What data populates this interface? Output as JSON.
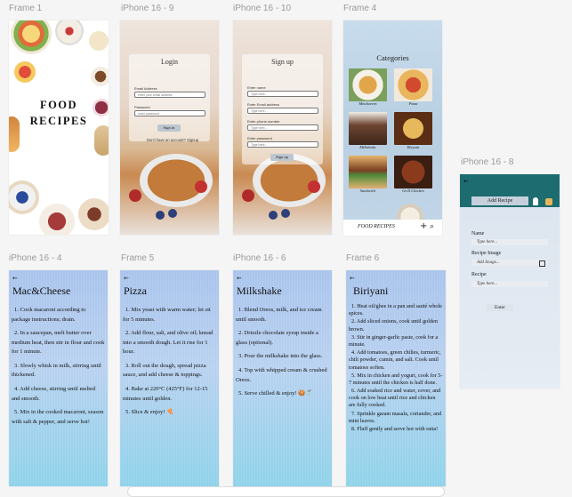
{
  "frames": {
    "frame1": {
      "label": "Frame 1",
      "title_line1": "FOOD",
      "title_line2": "RECIPES"
    },
    "login": {
      "label": "iPhone 16 - 9",
      "title": "Login",
      "email_label": "Email Address",
      "email_placeholder": "enter your email address",
      "password_label": "Password",
      "password_placeholder": "enter password",
      "signin_button": "Sign in",
      "no_account_text": "Don't have an account? Signup"
    },
    "signup": {
      "label": "iPhone 16 - 10",
      "title": "Sign up",
      "name_label": "Enter name",
      "name_placeholder": "Type here...",
      "email_label": "Enter Email address",
      "email_placeholder": "Type here...",
      "phone_label": "Enter phone number",
      "phone_placeholder": "Type here...",
      "password_label": "Enter password",
      "password_placeholder": "Type here...",
      "signup_button": "Sign up"
    },
    "categories": {
      "label": "Frame 4",
      "title": "Categories",
      "items": [
        "Mealsteees",
        "Pizza",
        "Milkshake",
        "Biryani",
        "Sandwich",
        "Grill Chicken"
      ],
      "footer_brand": "FOOD RECIPES",
      "plus_icon": "+",
      "search_icon": "⌕"
    },
    "add_recipe": {
      "label": "iPhone 16 - 8",
      "back": "←",
      "add_button": "Add Recipe",
      "name_label": "Name",
      "name_placeholder": "Type here...",
      "image_label": "Recipe Image",
      "image_placeholder": "Add Image...",
      "recipe_label": "Recipe",
      "recipe_placeholder": "Type here...",
      "enter_button": "Enter"
    },
    "mac": {
      "label": "iPhone 16 - 4",
      "back": "←",
      "title": "Mac&Cheese",
      "steps": [
        "1. Cook macaroni according to package instructions; drain.",
        "2. In a saucepan, melt butter over medium heat, then stir in flour and cook for 1 minute.",
        "3. Slowly whisk in milk, stirring until thickened.",
        "4. Add cheese, stirring until melted and smooth.",
        "5. Mix in the cooked macaroni, season with salt & pepper, and serve hot!"
      ]
    },
    "pizza": {
      "label": "Frame 5",
      "back": "←",
      "title": "Pizza",
      "steps": [
        "1. Mix yeast with warm water; let sit for 5 minutes.",
        "2. Add flour, salt, and olive oil; knead into a smooth dough. Let it rise for 1 hour.",
        "3. Roll out the dough, spread pizza sauce, and add cheese & toppings.",
        "4. Bake at 220°C (425°F) for 12-15 minutes until golden.",
        "5. Slice & enjoy! 🍕"
      ]
    },
    "milkshake": {
      "label": "iPhone 16 - 6",
      "back": "←",
      "title": "Milkshake",
      "steps": [
        "1. Blend Oreos, milk, and ice cream until smooth.",
        "2. Drizzle chocolate syrup inside a glass (optional).",
        "3. Pour the milkshake into the glass.",
        "4. Top with whipped cream & crushed Oreos.",
        "5. Serve chilled & enjoy! 🍪🥤"
      ]
    },
    "biryani": {
      "label": "Frame 6",
      "back": "←",
      "title": "Biriyani",
      "steps": [
        "1. Heat oil/ghee in a pan and sauté whole spices.",
        "2. Add sliced onions, cook until golden brown.",
        "3. Stir in ginger-garlic paste, cook for a minute.",
        "4. Add tomatoes, green chilies, turmeric, chili powder, cumin, and salt. Cook until tomatoes soften.",
        "5. Mix in chicken and yogurt, cook for 5-7 minutes until the chicken is half done.",
        "6. Add soaked rice and water, cover, and cook on low heat until rice and chicken are fully cooked.",
        "7. Sprinkle garam masala, coriander, and mint leaves.",
        "8. Fluff gently and serve hot with raita!"
      ]
    }
  }
}
